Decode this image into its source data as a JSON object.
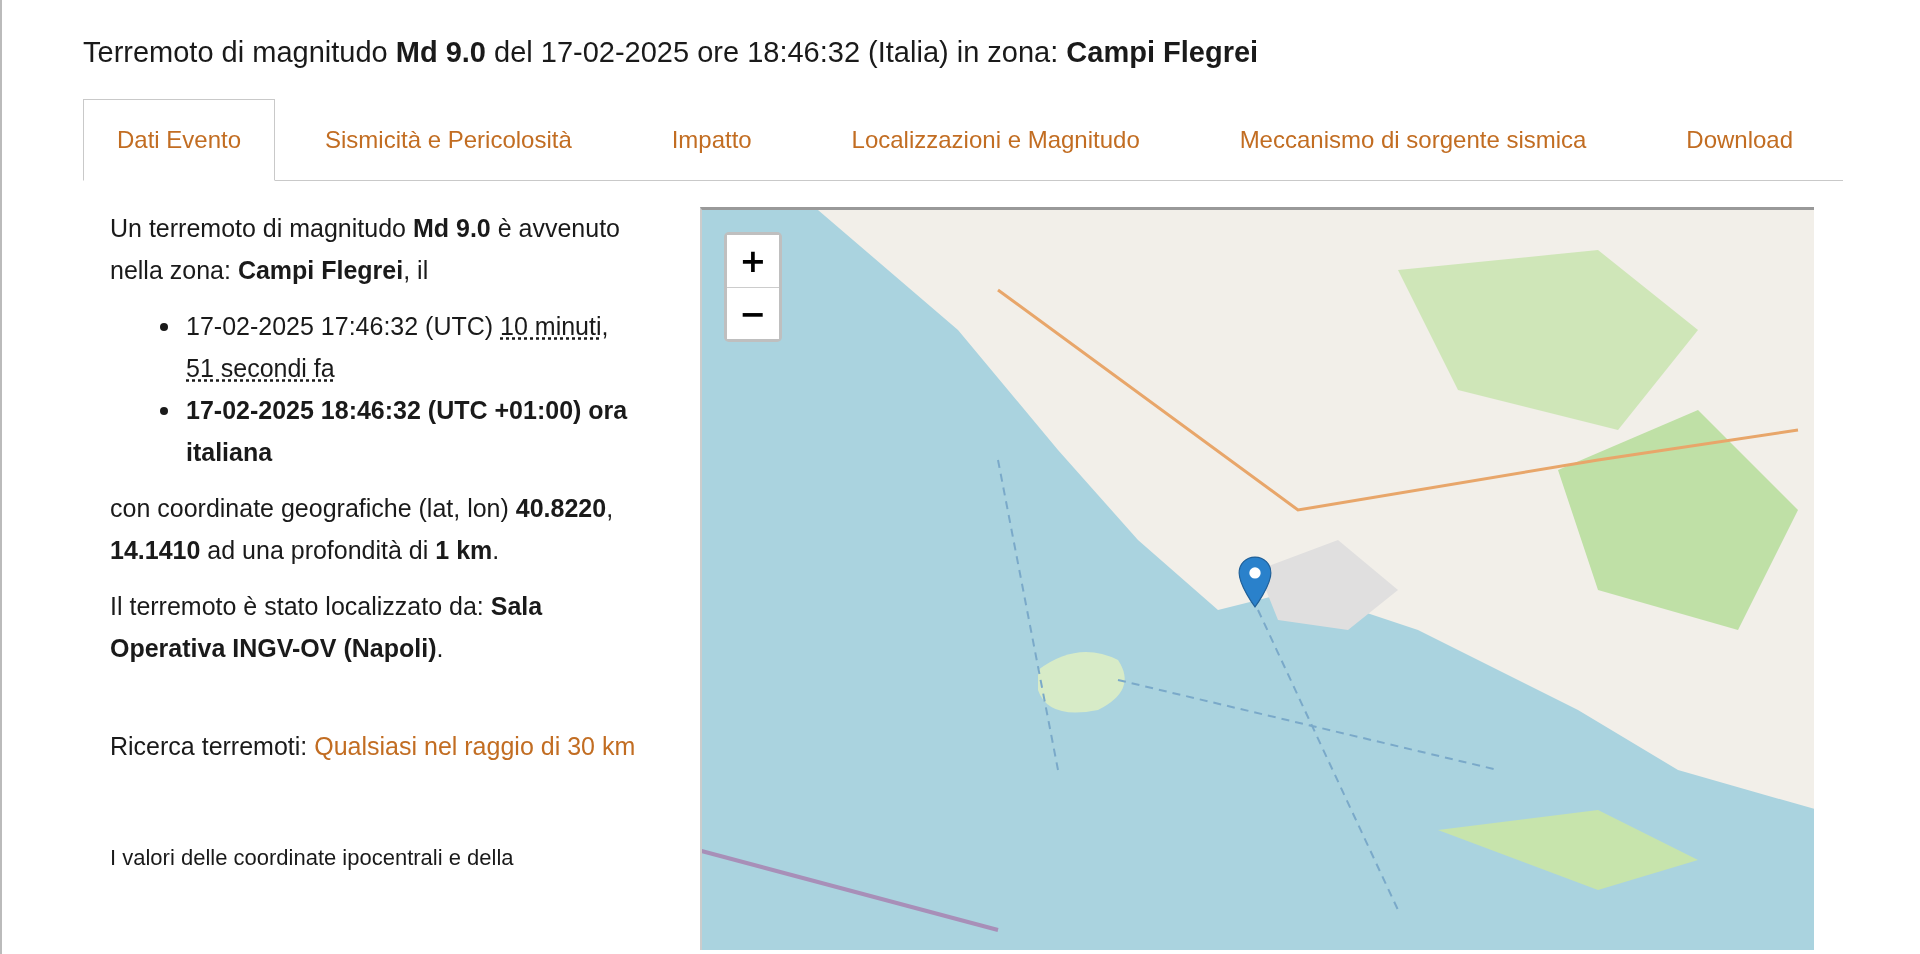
{
  "title": "Terremoto di magnitudo **Md 9.0** del 17-02-2025 ore 18:46:32 (Italia) in zona: **Campi Flegrei**",
  "tabs": [
    {
      "label": "Dati Evento",
      "selected": true
    },
    {
      "label": "Sismicità e Pericolosità",
      "selected": false
    },
    {
      "label": "Impatto",
      "selected": false
    },
    {
      "label": "Localizzazioni e Magnitudo",
      "selected": false
    },
    {
      "label": "Meccanismo di sorgente sismica",
      "selected": false
    },
    {
      "label": "Download",
      "selected": false
    }
  ],
  "intro": "Un terremoto di magnitudo **Md 9.0** è avvenuto nella zona: **Campi Flegrei**, il",
  "times": [
    {
      "kind": "utc",
      "text": "17-02-2025 17:46:32 (UTC)",
      "ago": "10 minuti, 51 secondi fa"
    },
    {
      "kind": "local",
      "text": "17-02-2025 18:46:32 (UTC +01:00) ora italiana"
    }
  ],
  "coordinates": "con coordinate geografiche (lat, lon) **40.8220**, **14.1410** ad una profondità di **1 km**.",
  "located_by": "Il terremoto è stato localizzato da: **Sala Operativa INGV-OV (Napoli)**.",
  "search": {
    "label": "Ricerca terremoti:",
    "link": "Qualsiasi nel raggio di 30 km"
  },
  "note": "I valori delle coordinate ipocentrali e della",
  "map": {
    "kind": "picture",
    "zoom_in": "+",
    "zoom_out": "−"
  }
}
